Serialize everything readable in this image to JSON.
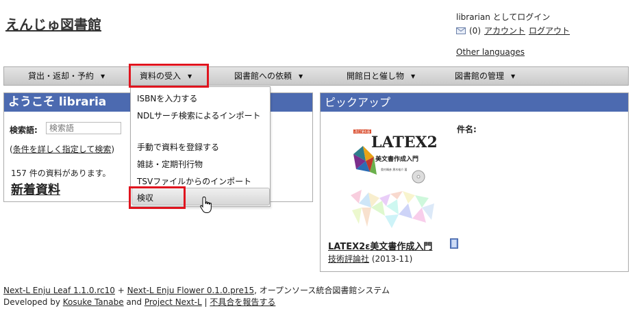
{
  "header": {
    "site_title": "えんじゅ図書館",
    "login_status": "librarian としてログイン",
    "message_count": "(0)",
    "account_link": "アカウント",
    "logout_link": "ログアウト",
    "other_languages": "Other languages"
  },
  "menubar": {
    "items": [
      {
        "label": "貸出・返却・予約"
      },
      {
        "label": "資料の受入"
      },
      {
        "label": "図書館への依頼"
      },
      {
        "label": "開館日と催し物"
      },
      {
        "label": "図書館の管理"
      }
    ]
  },
  "dropdown": {
    "items": [
      {
        "label": "ISBNを入力する"
      },
      {
        "label": "NDLサーチ検索によるインポート"
      },
      {
        "label": "手動で資料を登録する"
      },
      {
        "label": "雑誌・定期刊行物"
      },
      {
        "label": "TSVファイルからのインポート"
      },
      {
        "label": "検収"
      }
    ]
  },
  "welcome": {
    "title": "ようこそ libraria",
    "search_label": "検索語:",
    "search_placeholder": "検索語",
    "advanced_search_prefix": "(",
    "advanced_search_link": "条件を詳しく指定して検索",
    "advanced_search_suffix": ")",
    "count_text": "157 件の資料があります。",
    "new_items": "新着資料"
  },
  "pickup": {
    "title": "ピックアップ",
    "subject_label": "件名:",
    "book_title": "LATEX2ε美文書作成入門",
    "publisher": "技術評論社",
    "year": "(2013-11)",
    "cover": {
      "edition_badge": "改訂第6版",
      "logo": "LATEX2ε",
      "subtitle": "美文書作成入門",
      "authors": "奥村晴彦  黒木裕介 著"
    }
  },
  "footer": {
    "leaf_link": "Next-L Enju Leaf 1.1.0.rc10",
    "plus": " + ",
    "flower_link": "Next-L Enju Flower 0.1.0.pre15",
    "tagline": ", オープンソース統合図書館システム",
    "developed_by": "Developed by ",
    "author_link": "Kosuke Tanabe",
    "and": " and ",
    "project_link": "Project Next-L",
    "separator": " | ",
    "report_link": "不具合を報告する"
  },
  "colors": {
    "panel_header": "#4c6ab0",
    "highlight": "#e0141e"
  }
}
